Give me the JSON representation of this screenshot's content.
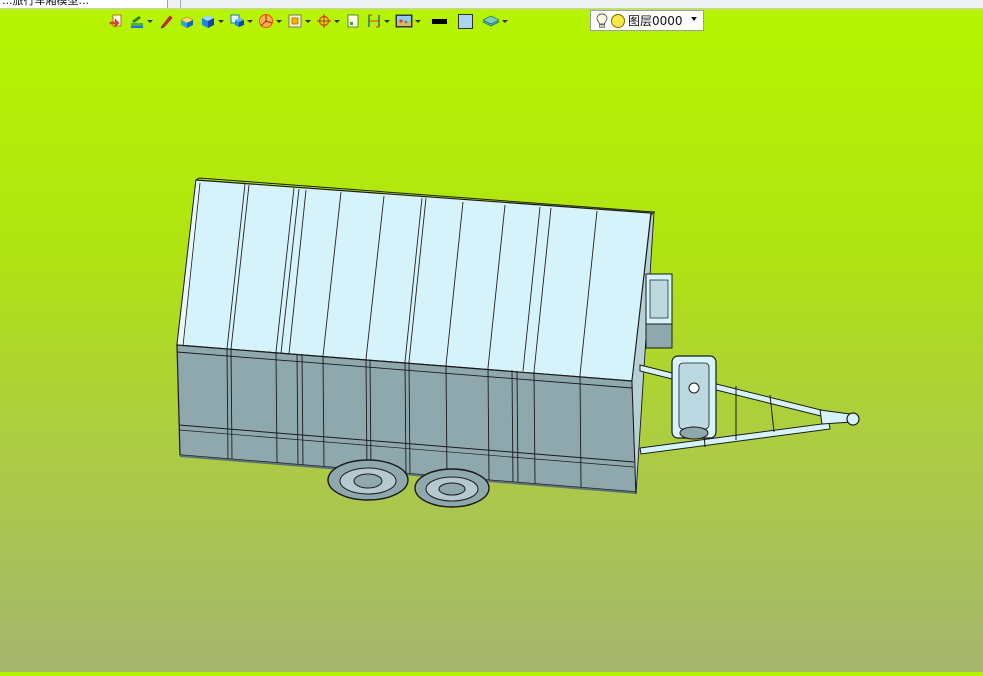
{
  "window": {
    "tab_title": "...旅行车厢模型..."
  },
  "toolbar": {
    "items": [
      {
        "name": "exit-sketch-icon",
        "dropdown": false
      },
      {
        "name": "sketch-draw-icon",
        "dropdown": true
      },
      {
        "name": "pencil-icon",
        "dropdown": false
      },
      {
        "name": "extrude-icon",
        "dropdown": false
      },
      {
        "name": "solid-box-icon",
        "dropdown": true
      },
      {
        "name": "shell-icon",
        "dropdown": true
      },
      {
        "name": "color-wheel-icon",
        "dropdown": true
      },
      {
        "name": "surface-icon",
        "dropdown": true
      },
      {
        "name": "target-point-icon",
        "dropdown": true
      },
      {
        "name": "plane-icon",
        "dropdown": false
      },
      {
        "name": "dimension-icon",
        "dropdown": true
      },
      {
        "name": "render-scene-icon",
        "dropdown": true
      },
      {
        "name": "line-color-swatch",
        "dropdown": false
      },
      {
        "name": "fill-color-swatch",
        "dropdown": false
      },
      {
        "name": "layers-icon",
        "dropdown": true
      }
    ],
    "colors": {
      "line_swatch": "#000000",
      "fill_swatch": "#a9d4f2"
    }
  },
  "layer_selector": {
    "value": "图层0000"
  },
  "viewport": {
    "background_top": "#b6f500",
    "background_bottom": "#a6b66f",
    "model_face_top": "#d6f2fb",
    "model_face_side": "#8ea8ae",
    "model_edge": "#1a1a1a"
  }
}
